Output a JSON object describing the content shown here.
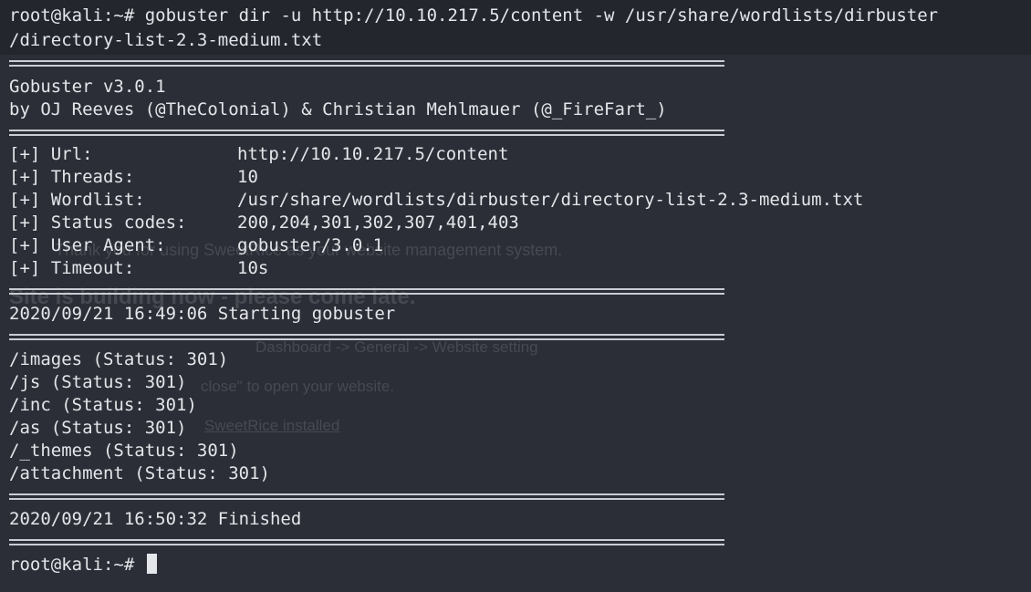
{
  "command": {
    "prompt": "root@kali:~#",
    "line1_text": "gobuster dir -u http://10.10.217.5/content -w /usr/share/wordlists/dirbuster",
    "line2_text": "/directory-list-2.3-medium.txt"
  },
  "banner": {
    "title": "Gobuster v3.0.1",
    "authors": "by OJ Reeves (@TheColonial) & Christian Mehlmauer (@_FireFart_)"
  },
  "config": [
    {
      "key": "[+] Url:",
      "value": "http://10.10.217.5/content"
    },
    {
      "key": "[+] Threads:",
      "value": "10"
    },
    {
      "key": "[+] Wordlist:",
      "value": "/usr/share/wordlists/dirbuster/directory-list-2.3-medium.txt"
    },
    {
      "key": "[+] Status codes:",
      "value": "200,204,301,302,307,401,403"
    },
    {
      "key": "[+] User Agent:",
      "value": "gobuster/3.0.1"
    },
    {
      "key": "[+] Timeout:",
      "value": "10s"
    }
  ],
  "start_message": "2020/09/21 16:49:06 Starting gobuster",
  "results": [
    "/images (Status: 301)",
    "/js (Status: 301)",
    "/inc (Status: 301)",
    "/as (Status: 301)",
    "/_themes (Status: 301)",
    "/attachment (Status: 301)"
  ],
  "finish_message": "2020/09/21 16:50:32 Finished",
  "final_prompt": "root@kali:~#",
  "background_page": {
    "line1": "Thank you for using SweetRice as your website management system.",
    "line2": "Site is building now - please come late.",
    "line3": "Dashboard -> General -> Website setting",
    "line4": "close\" to open your website.",
    "line5": "SweetRice installed"
  },
  "colors": {
    "background": "#2b2e36",
    "command_band": "#23262d",
    "text": "#e4e6ea"
  }
}
